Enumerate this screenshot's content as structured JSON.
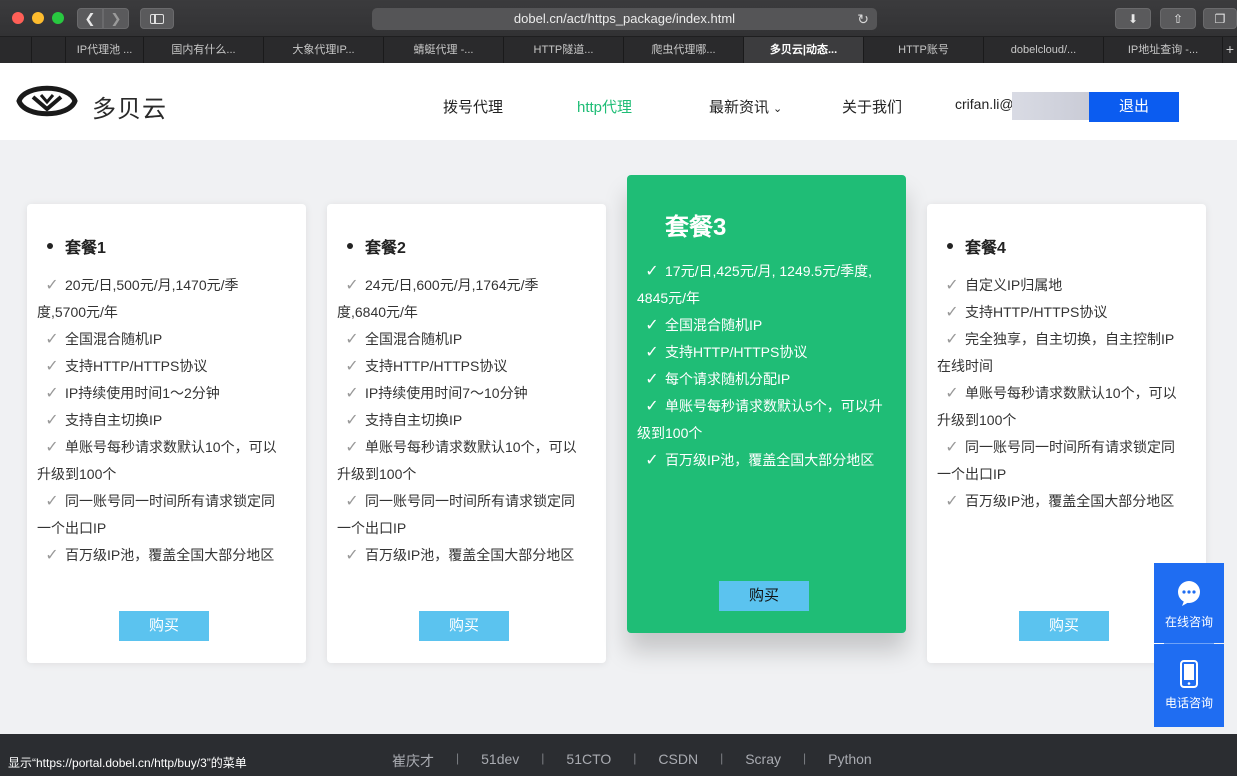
{
  "browser": {
    "url": "dobel.cn/act/https_package/index.html",
    "tabs": [
      "IP代理池 ...",
      "国内有什么...",
      "大象代理IP...",
      "蜻蜓代理 -...",
      "HTTP隧道...",
      "爬虫代理哪...",
      "多贝云|动态...",
      "HTTP账号",
      "dobelcloud/...",
      "IP地址查询 -..."
    ],
    "active_tab": 6
  },
  "header": {
    "logo_text": "多贝云",
    "nav": [
      "拨号代理",
      "http代理",
      "最新资讯",
      "关于我们"
    ],
    "active_nav": 1,
    "username": "crifan.li@",
    "logout": "退出"
  },
  "packages": [
    {
      "title": "套餐1",
      "features": [
        "20元/日,500元/月,1470元/季度,5700元/年",
        "全国混合随机IP",
        "支持HTTP/HTTPS协议",
        "IP持续使用时间1～2分钟",
        "支持自主切换IP",
        "单账号每秒请求数默认10个，可以升级到100个",
        "同一账号同一时间所有请求锁定同一个出口IP",
        "百万级IP池，覆盖全国大部分地区"
      ],
      "buy": "购买"
    },
    {
      "title": "套餐2",
      "features": [
        "24元/日,600元/月,1764元/季度,6840元/年",
        "全国混合随机IP",
        "支持HTTP/HTTPS协议",
        "IP持续使用时间7～10分钟",
        "支持自主切换IP",
        "单账号每秒请求数默认10个，可以升级到100个",
        "同一账号同一时间所有请求锁定同一个出口IP",
        "百万级IP池，覆盖全国大部分地区"
      ],
      "buy": "购买"
    },
    {
      "title": "套餐3",
      "features": [
        "17元/日,425元/月, 1249.5元/季度, 4845元/年",
        "全国混合随机IP",
        "支持HTTP/HTTPS协议",
        "每个请求随机分配IP",
        "单账号每秒请求数默认5个，可以升级到100个",
        "百万级IP池，覆盖全国大部分地区"
      ],
      "buy": "购买"
    },
    {
      "title": "套餐4",
      "features": [
        "自定义IP归属地",
        "支持HTTP/HTTPS协议",
        "完全独享，自主切换，自主控制IP在线时间",
        "单账号每秒请求数默认10个，可以升级到100个",
        "同一账号同一时间所有请求锁定同一个出口IP",
        "百万级IP池，覆盖全国大部分地区"
      ],
      "buy": "购买"
    }
  ],
  "float": {
    "online": "在线咨询",
    "phone": "电话咨询"
  },
  "footer": {
    "status": "显示“https://portal.dobel.cn/http/buy/3”的菜单",
    "links": [
      "崔庆才",
      "51dev",
      "51CTO",
      "CSDN",
      "Scray",
      "Python"
    ]
  }
}
